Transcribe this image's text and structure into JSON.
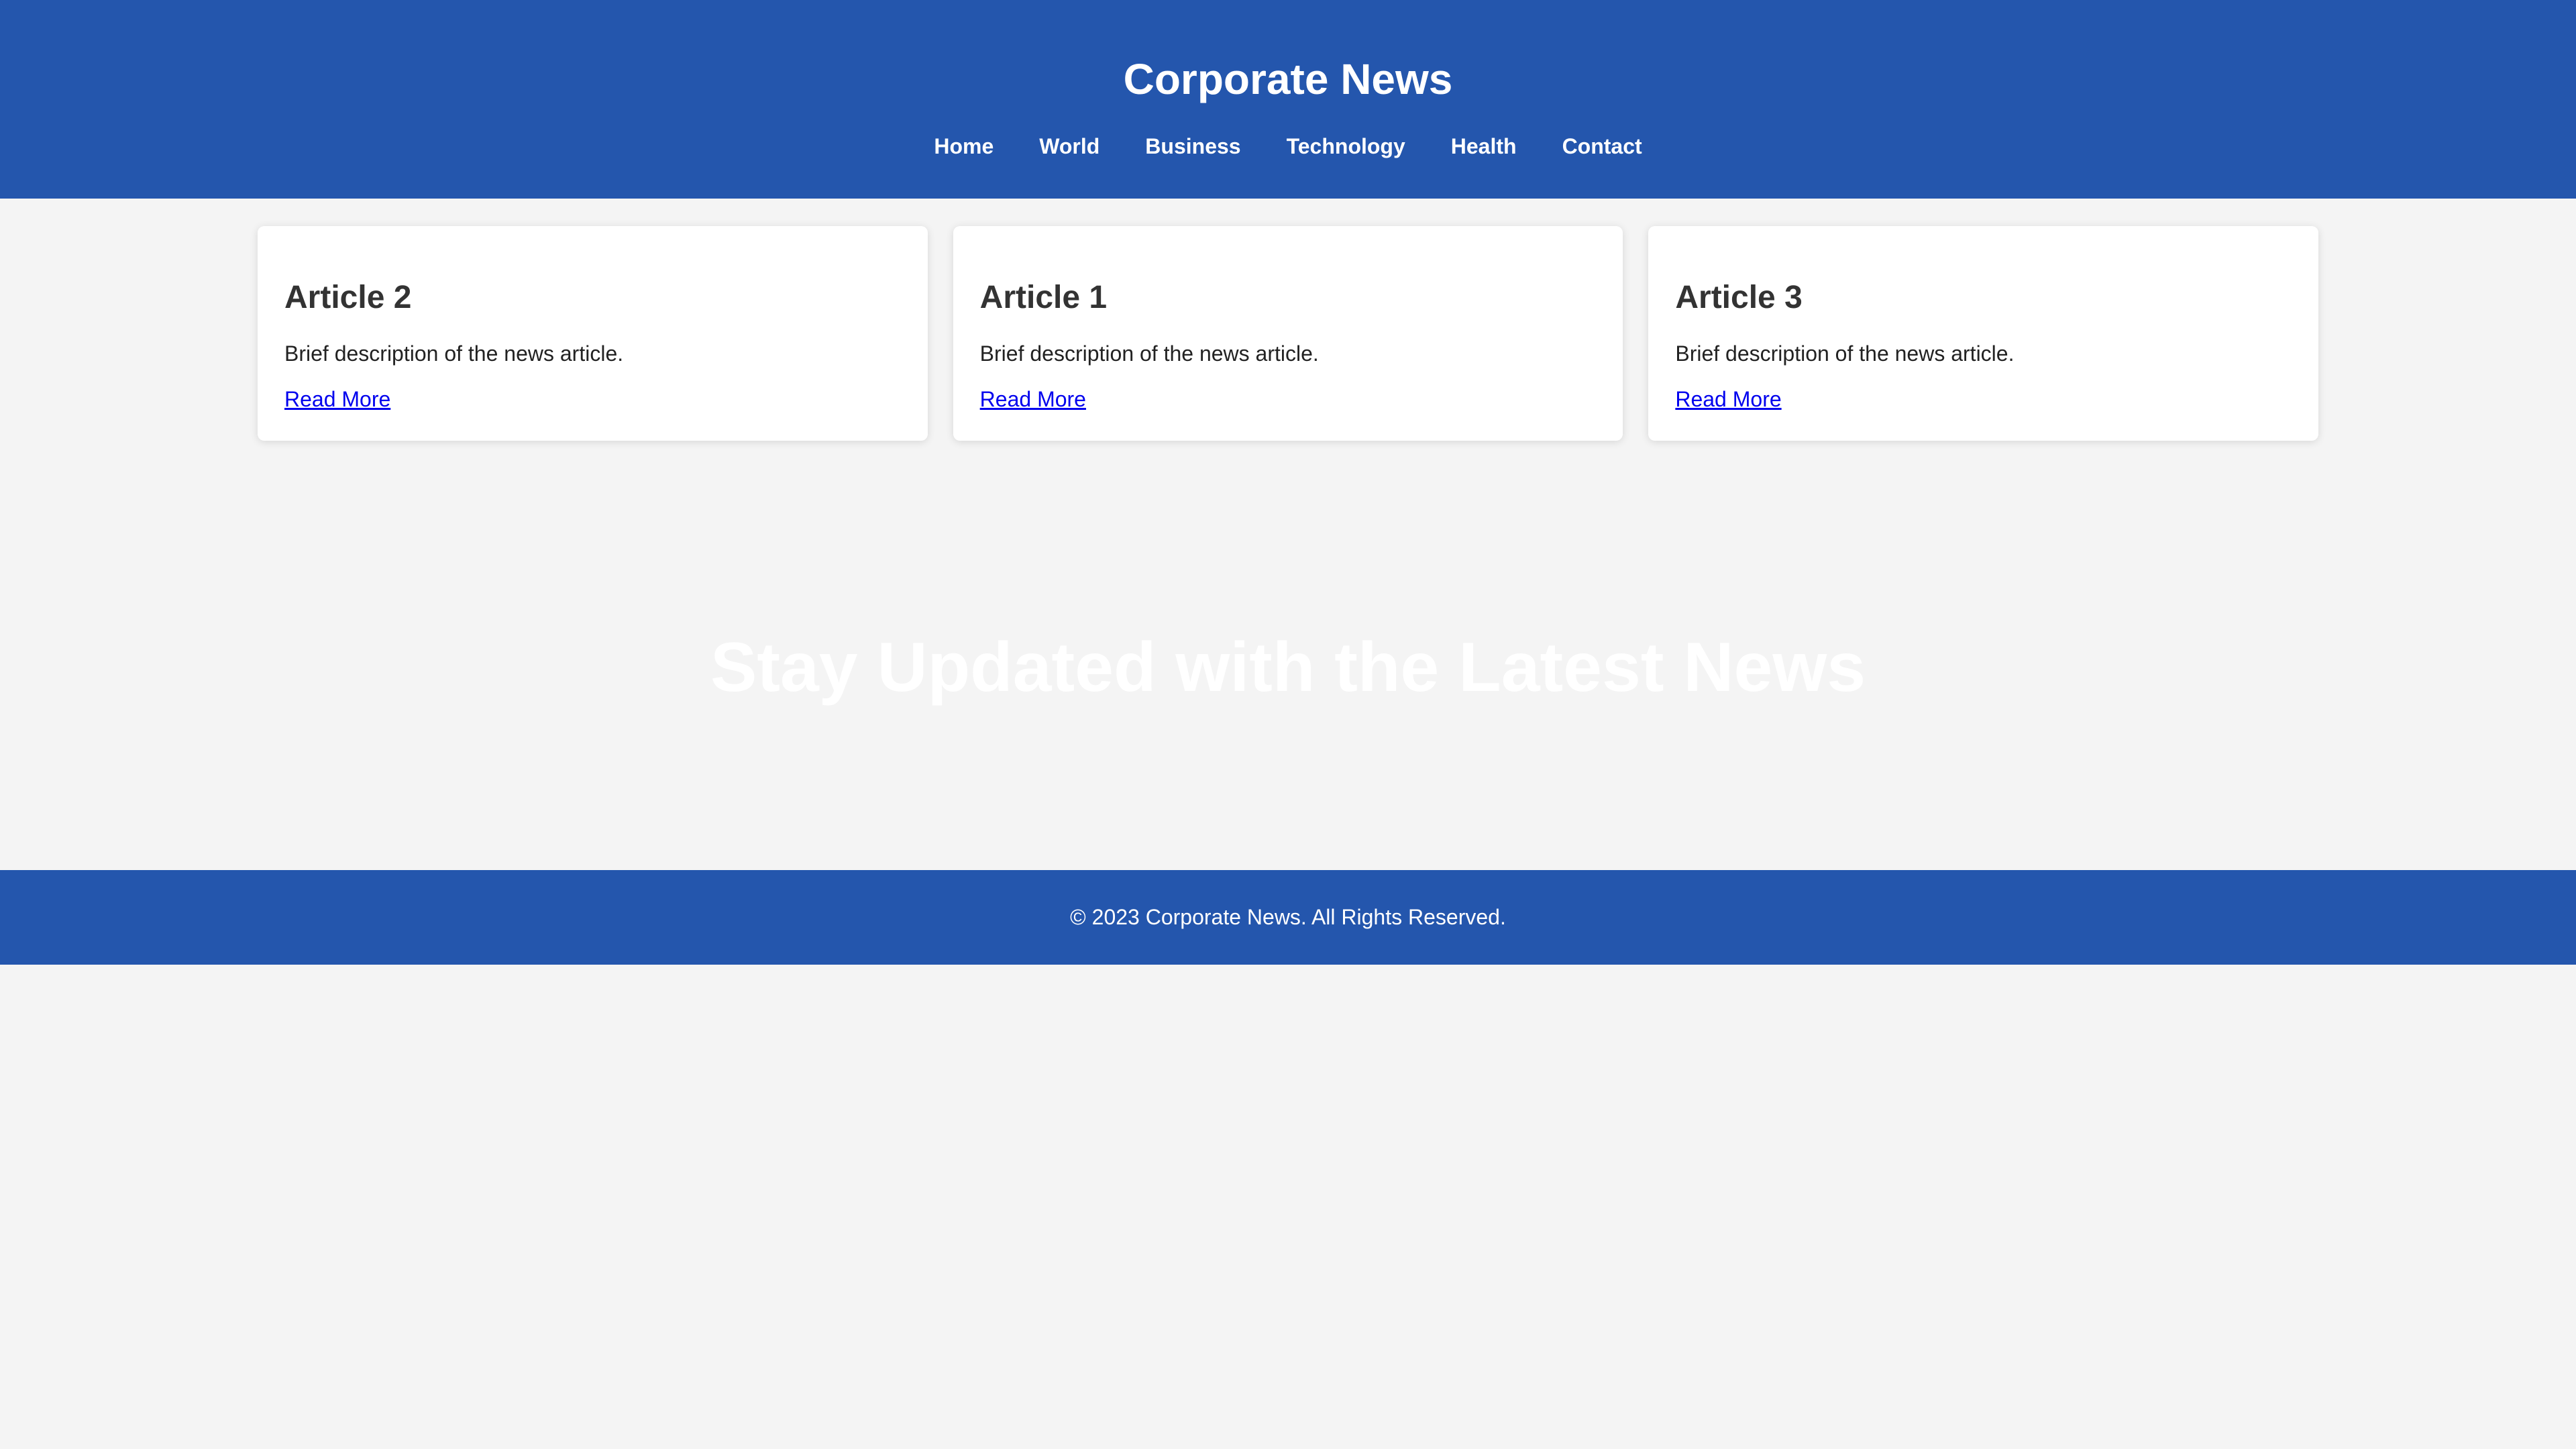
{
  "header": {
    "title": "Corporate News",
    "nav": [
      {
        "label": "Home"
      },
      {
        "label": "World"
      },
      {
        "label": "Business"
      },
      {
        "label": "Technology"
      },
      {
        "label": "Health"
      },
      {
        "label": "Contact"
      }
    ]
  },
  "articles": [
    {
      "title": "Article 2",
      "description": "Brief description of the news article.",
      "link": "Read More"
    },
    {
      "title": "Article 1",
      "description": "Brief description of the news article.",
      "link": "Read More"
    },
    {
      "title": "Article 3",
      "description": "Brief description of the news article.",
      "link": "Read More"
    }
  ],
  "hero": {
    "headline": "Stay Updated with the Latest News"
  },
  "footer": {
    "text": "© 2023 Corporate News. All Rights Reserved."
  },
  "colors": {
    "brand": "#2456ad",
    "background": "#f4f4f4",
    "link": "#0000ee"
  }
}
